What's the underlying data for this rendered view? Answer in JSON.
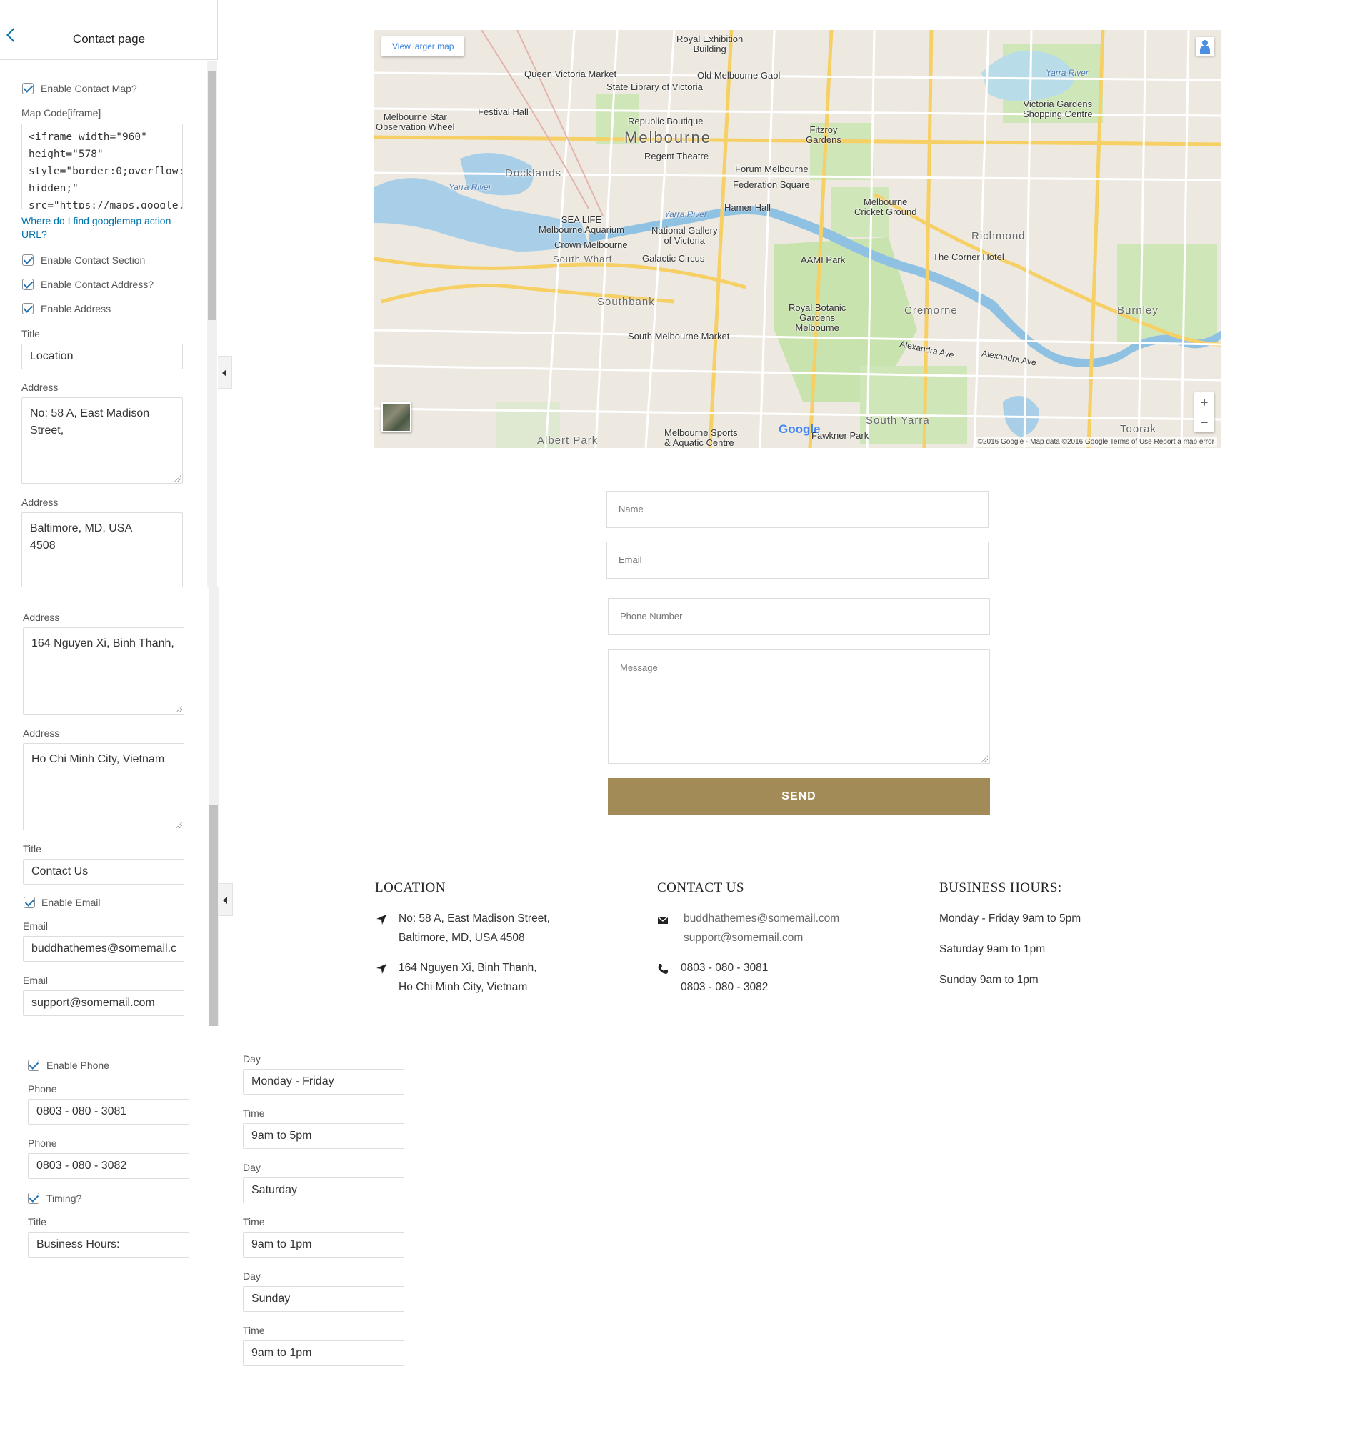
{
  "customizer": {
    "back_label": "<",
    "title": "Contact page",
    "enable_map_label": "Enable Contact Map?",
    "map_code_label": "Map Code[iframe]",
    "map_code_value": "<iframe width=\"960\"\nheight=\"578\"\nstyle=\"border:0;overflow:\nhidden;\"\nsrc=\"https://maps.google.",
    "help_link": "Where do I find googlemap action URL?",
    "enable_contact_section_label": "Enable Contact Section",
    "enable_contact_address_label": "Enable Contact Address?",
    "enable_address_label": "Enable Address",
    "title_label": "Title",
    "location_title_value": "Location",
    "address_label": "Address",
    "address_1": "No: 58 A, East Madison\nStreet,",
    "address_2": "Baltimore, MD, USA\n4508",
    "address_3": "164 Nguyen Xi, Binh Thanh,",
    "address_4": "Ho Chi Minh City, Vietnam",
    "contact_title_value": "Contact Us",
    "enable_email_label": "Enable Email",
    "email_label": "Email",
    "email_1": "buddhathemes@somemail.c",
    "email_2": "support@somemail.com",
    "enable_phone_label": "Enable Phone",
    "phone_label": "Phone",
    "phone_1": "0803 - 080 - 3081",
    "phone_2": "0803 - 080 - 3082",
    "timing_label": "Timing?",
    "hours_title_value": "Business Hours:",
    "day_label": "Day",
    "time_label": "Time",
    "day_1": "Monday - Friday",
    "time_1": "9am to 5pm",
    "day_2": "Saturday",
    "time_2": "9am to 1pm",
    "day_3": "Sunday",
    "time_3": "9am to 1pm"
  },
  "map": {
    "view_larger": "View larger map",
    "zoom_in": "+",
    "zoom_out": "−",
    "attribution": "©2016 Google - Map data ©2016 Google    Terms of Use    Report a map error",
    "google": "Google",
    "labels": {
      "melbourne": "Melbourne",
      "docklands": "Docklands",
      "southbank": "Southbank",
      "richmond": "Richmond",
      "cremorne": "Cremorne",
      "burnley": "Burnley",
      "south_yarra": "South Yarra",
      "toorak": "Toorak",
      "albert_park": "Albert Park",
      "royal_exhibition": "Royal Exhibition\nBuilding",
      "queen_vic": "Queen Victoria Market",
      "old_gaol": "Old Melbourne Gaol",
      "state_library": "State Library of Victoria",
      "star_wheel": "Melbourne Star\nObservation Wheel",
      "festival_hall": "Festival Hall",
      "republic": "Republic Boutique",
      "fitzroy": "Fitzroy\nGardens",
      "regent": "Regent Theatre",
      "forum": "Forum Melbourne",
      "federation": "Federation Square",
      "victoria_gardens": "Victoria Gardens\nShopping Centre",
      "yarra_river": "Yarra River",
      "yarra_river2": "Yarra River",
      "yarra_river3": "Yarra River",
      "hamer": "Hamer Hall",
      "mcg": "Melbourne\nCricket Ground",
      "sealife": "SEA LIFE\nMelbourne Aquarium",
      "ngv": "National Gallery\nof Victoria",
      "crown": "Crown Melbourne",
      "south_wharf": "South Wharf",
      "galactic": "Galactic Circus",
      "aami": "AAMI Park",
      "corner": "The Corner Hotel",
      "botanic": "Royal Botanic\nGardens\nMelbourne",
      "smm": "South Melbourne Market",
      "sports": "Melbourne Sports\n& Aquatic Centre",
      "fawkner": "Fawkner Park",
      "alexandra": "Alexandra Ave",
      "alexandra2": "Alexandra Ave"
    }
  },
  "form": {
    "name_placeholder": "Name",
    "email_placeholder": "Email",
    "phone_placeholder": "Phone Number",
    "message_placeholder": "Message",
    "send_label": "SEND"
  },
  "info": {
    "location_heading": "LOCATION",
    "location_1a": "No: 58 A, East Madison Street,",
    "location_1b": "Baltimore, MD, USA 4508",
    "location_2a": "164 Nguyen Xi, Binh Thanh,",
    "location_2b": "Ho Chi Minh City, Vietnam",
    "contact_heading": "CONTACT US",
    "email_1": "buddhathemes@somemail.com",
    "email_2": "support@somemail.com",
    "phone_1": "0803 - 080 - 3081",
    "phone_2": "0803 - 080 - 3082",
    "hours_heading": "BUSINESS HOURS:",
    "hours_1": "Monday - Friday 9am to 5pm",
    "hours_2": "Saturday 9am to 1pm",
    "hours_3": "Sunday 9am to 1pm"
  },
  "colors": {
    "accent_button": "#a38b58",
    "checkbox_blue": "#2271b1",
    "link_blue": "#0073aa"
  }
}
